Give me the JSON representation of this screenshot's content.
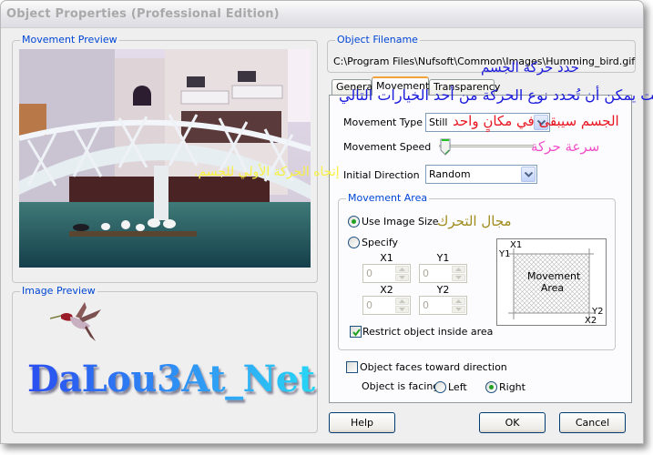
{
  "window": {
    "title": "Object Properties (Professional Edition)"
  },
  "movement_preview": {
    "label": "Movement Preview",
    "image_desc": "photo of a white arched bridge over a pond with ducks, ornate building behind"
  },
  "image_preview": {
    "label": "Image Preview",
    "image_desc": "hummingbird sprite"
  },
  "object_filename": {
    "label": "Object Filename",
    "value": "C:\\Program Files\\Nufsoft\\Common\\Images\\Humming_bird.gif"
  },
  "tabs": [
    {
      "label": "General",
      "active": false
    },
    {
      "label": "Movement",
      "active": true
    },
    {
      "label": "Transparency",
      "active": false
    }
  ],
  "movement": {
    "type_label": "Movement Type",
    "type_value": "Still",
    "speed_label": "Movement Speed",
    "speed_fraction": 0.05,
    "direction_label": "Initial Direction",
    "direction_value": "Random"
  },
  "movement_area": {
    "label": "Movement Area",
    "use_image_size_label": "Use Image Size",
    "use_image_size_checked": true,
    "specify_label": "Specify",
    "specify_checked": false,
    "fields": [
      {
        "label": "X1",
        "value": "0"
      },
      {
        "label": "Y1",
        "value": "0"
      },
      {
        "label": "X2",
        "value": "0"
      },
      {
        "label": "Y2",
        "value": "0"
      }
    ],
    "restrict_label": "Restrict object inside area",
    "restrict_checked": true,
    "diagram": {
      "x1": "X1",
      "y1": "Y1",
      "x2": "X2",
      "y2": "Y2",
      "center_line1": "Movement",
      "center_line2": "Area"
    }
  },
  "facing": {
    "faces_toward_label": "Object faces toward direction",
    "faces_toward_checked": false,
    "is_facing_label": "Object is facing",
    "left_label": "Left",
    "right_label": "Right",
    "selected": "Right"
  },
  "buttons": {
    "help": "Help",
    "ok": "OK",
    "cancel": "Cancel"
  },
  "annotations": {
    "choose_movement": "حدد حركة الجسم",
    "choose_type": "أنت يمكن أن تُحدد نوع الحركة من أحد الخيارات التالي",
    "stays_still": "الجسم سيبقى في مكانٍ واحد",
    "speed": "سرعة حركة",
    "initial_direction": "إتجاه الحركة الأولي للجسم.",
    "movement_area": "مجال التحرك",
    "colors": {
      "blue": "#1a1adc",
      "red": "#e8141e",
      "pink": "#f050c8",
      "yellow": "#f8f040",
      "olive": "#a08c1e"
    }
  },
  "watermark": "DaLou3At_Net"
}
